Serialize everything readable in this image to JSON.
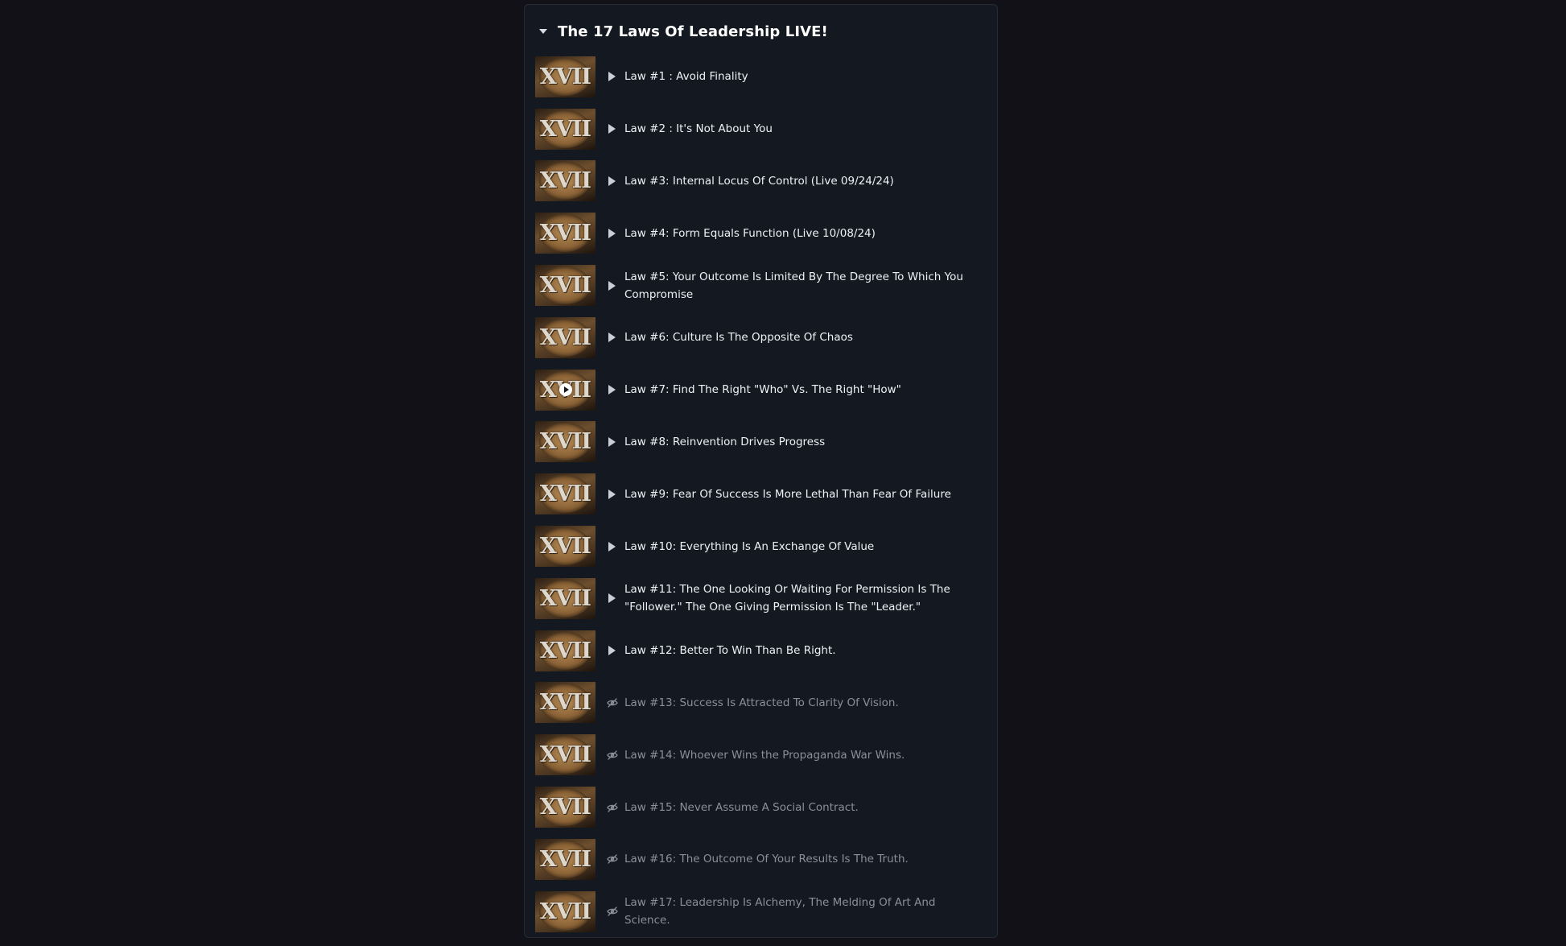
{
  "section": {
    "title": "The 17 Laws Of Leadership LIVE!",
    "thumbnail_text": "XVII",
    "lessons": [
      {
        "title": "Law #1 : Avoid Finality",
        "status": "available"
      },
      {
        "title": "Law #2 : It's Not About You",
        "status": "available"
      },
      {
        "title": "Law #3: Internal Locus Of Control (Live 09/24/24)",
        "status": "available"
      },
      {
        "title": "Law #4: Form Equals Function (Live 10/08/24)",
        "status": "available"
      },
      {
        "title": "Law #5: Your Outcome Is Limited By The Degree To Which You Compromise",
        "status": "available"
      },
      {
        "title": "Law #6: Culture Is The Opposite Of Chaos",
        "status": "available"
      },
      {
        "title": "Law #7: Find The Right \"Who\" Vs. The Right \"How\"",
        "status": "available",
        "current": true
      },
      {
        "title": "Law #8: Reinvention Drives Progress",
        "status": "available"
      },
      {
        "title": "Law #9: Fear Of Success Is More Lethal Than Fear Of Failure",
        "status": "available"
      },
      {
        "title": "Law #10: Everything Is An Exchange Of Value",
        "status": "available"
      },
      {
        "title": "Law #11: The One Looking Or Waiting For Permission Is The \"Follower.\" The One Giving Permission Is The \"Leader.\"",
        "status": "available"
      },
      {
        "title": "Law #12: Better To Win Than Be Right.",
        "status": "available"
      },
      {
        "title": "Law #13: Success Is Attracted To Clarity Of Vision.",
        "status": "hidden"
      },
      {
        "title": "Law #14: Whoever Wins the Propaganda War Wins.",
        "status": "hidden"
      },
      {
        "title": "Law #15: Never Assume A Social Contract.",
        "status": "hidden"
      },
      {
        "title": "Law #16: The Outcome Of Your Results Is The Truth.",
        "status": "hidden"
      },
      {
        "title": "Law #17: Leadership Is Alchemy, The Melding Of Art And Science.",
        "status": "hidden"
      }
    ]
  },
  "icons": {
    "collapse": "caret-down-icon",
    "available": "play-icon",
    "hidden": "eye-off-icon",
    "current": "play-circle-icon"
  },
  "colors": {
    "page_background": "#121118",
    "panel_background": "#141921",
    "text_primary": "#eef1f6",
    "text_muted": "#8a8f98"
  }
}
